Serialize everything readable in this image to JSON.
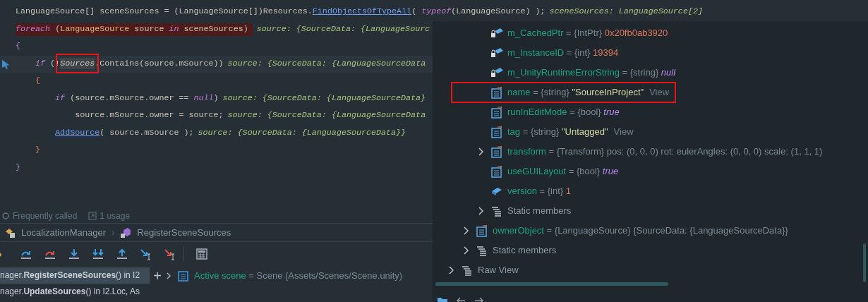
{
  "editor": {
    "lines": [
      {
        "breakpoint": false,
        "current": false,
        "tokens": [
          {
            "text": "LanguageSource",
            "kind": "plain"
          },
          {
            "text": "[] sceneSources = (LanguageSource[])Resources.",
            "kind": "plain"
          },
          {
            "text": "FindObjectsOfTypeAll",
            "kind": "method"
          },
          {
            "text": "( ",
            "kind": "plain"
          },
          {
            "text": "typeof",
            "kind": "keyword"
          },
          {
            "text": "(LanguageSource) );",
            "kind": "plain"
          }
        ],
        "hint": "sceneSources: LanguageSource[2]"
      },
      {
        "breakpoint": true,
        "current": false,
        "tokens": [
          {
            "text": "foreach",
            "kind": "keyword"
          },
          {
            "text": " (",
            "kind": "plain"
          },
          {
            "text": "LanguageSource",
            "kind": "type"
          },
          {
            "text": " source ",
            "kind": "plain"
          },
          {
            "text": "in",
            "kind": "keyword"
          },
          {
            "text": " sceneSources)",
            "kind": "plain"
          }
        ],
        "hint": "source: {SourceData: {LanguageSourc"
      },
      {
        "breakpoint": false,
        "current": false,
        "tokens": [
          {
            "text": "{",
            "kind": "brace"
          }
        ]
      },
      {
        "breakpoint": false,
        "current": true,
        "tokens": [
          {
            "text": "    if",
            "kind": "keyword"
          },
          {
            "text": " (!",
            "kind": "plain"
          },
          {
            "text": "Sources",
            "kind": "member",
            "boxed": true
          },
          {
            "text": ".Contains(source.mSource))",
            "kind": "plain"
          }
        ],
        "hint": "source: {SourceData: {LanguageSourceData"
      },
      {
        "breakpoint": false,
        "current": false,
        "tokens": [
          {
            "text": "    {",
            "kind": "inner-brace"
          }
        ]
      },
      {
        "breakpoint": false,
        "current": false,
        "tokens": [
          {
            "text": "        if",
            "kind": "keyword"
          },
          {
            "text": " (source.mSource.owner == ",
            "kind": "plain"
          },
          {
            "text": "null",
            "kind": "keyword"
          },
          {
            "text": ")",
            "kind": "plain"
          }
        ],
        "hint": "source: {SourceData: {LanguageSourceData}"
      },
      {
        "breakpoint": false,
        "current": false,
        "tokens": [
          {
            "text": "            source.mSource.owner = source;",
            "kind": "plain"
          }
        ],
        "hint": "source: {SourceData: {LanguageSourceData"
      },
      {
        "breakpoint": false,
        "current": false,
        "tokens": [
          {
            "text": "        AddSource",
            "kind": "method"
          },
          {
            "text": "( source.mSource );",
            "kind": "plain"
          }
        ],
        "hint": "source: {SourceData: {LanguageSourceData}}"
      },
      {
        "breakpoint": false,
        "current": false,
        "tokens": [
          {
            "text": "    }",
            "kind": "inner-brace"
          }
        ]
      },
      {
        "breakpoint": false,
        "current": false,
        "tokens": [
          {
            "text": "}",
            "kind": "brace"
          }
        ]
      }
    ],
    "code_lens": [
      "Frequently called",
      "1 usage"
    ]
  },
  "breadcrumbs": [
    {
      "label": "LocalizationManager",
      "kind": "class"
    },
    {
      "separator": "›",
      "label": "RegisterSceneSources",
      "kind": "method"
    }
  ],
  "debug_toolbar": [
    {
      "kind": "step-back"
    },
    {
      "kind": "step-over"
    },
    {
      "kind": "step-over-red"
    },
    {
      "kind": "step-into"
    },
    {
      "kind": "step-into-double"
    },
    {
      "kind": "step-out"
    },
    {
      "kind": "run-to-cursor"
    },
    {
      "kind": "run-to-cursor-red"
    },
    {
      "kind": "calculator"
    }
  ],
  "frames": [
    {
      "text": "nager.**RegisterSceneSources**() in I2",
      "selected": true
    },
    {
      "text": "nager.**UpdateSources**() in I2.Loc, As",
      "selected": false
    }
  ],
  "add_button": "+",
  "variables": [
    {
      "name": "Active scene",
      "value": "= Scene (Assets/Scenes/Scene.unity)"
    }
  ],
  "popup": {
    "tree": [
      {
        "children": [
          {
            "children": [
              {
                "name": "m_CachedPtr",
                "type": "= {IntPtr}",
                "value": {
                  "text": "0x20fb0ab3920",
                  "kind": "number"
                },
                "kind": "locked-field",
                "expandable": false,
                "boxed": false
              },
              {
                "name": "m_InstanceID",
                "type": "= {int}",
                "value": {
                  "text": "19394",
                  "kind": "number"
                },
                "kind": "locked-field",
                "expandable": false,
                "boxed": false
              },
              {
                "name": "m_UnityRuntimeErrorString",
                "type": "= {string}",
                "value": {
                  "text": "null",
                  "kind": "keyword"
                },
                "kind": "locked-field",
                "expandable": false,
                "boxed": false
              },
              {
                "name": "name",
                "type": "= {string}",
                "value": {
                  "text": "\"SourceInProject\"",
                  "kind": "string"
                },
                "link": "View",
                "kind": "property",
                "expandable": false,
                "boxed": true
              },
              {
                "name": "runInEditMode",
                "type": "= {bool}",
                "value": {
                  "text": "true",
                  "kind": "keyword"
                },
                "kind": "property",
                "expandable": false,
                "boxed": false
              },
              {
                "name": "tag",
                "type": "= {string}",
                "value": {
                  "text": "\"Untagged\"",
                  "kind": "string"
                },
                "link": "View",
                "kind": "property",
                "expandable": false,
                "boxed": false
              },
              {
                "name": "transform",
                "type": "= {Transform}",
                "value": {
                  "text": "pos: (0, 0, 0) rot: eulerAngles: (0, 0, 0) scale: (1, 1, 1)",
                  "kind": "plain"
                },
                "kind": "property",
                "expandable": true,
                "boxed": false
              },
              {
                "name": "useGUILayout",
                "type": "= {bool}",
                "value": {
                  "text": "true",
                  "kind": "keyword"
                },
                "kind": "property",
                "expandable": false,
                "boxed": false
              },
              {
                "name": "version",
                "type": "= {int}",
                "value": {
                  "text": "1",
                  "kind": "number"
                },
                "kind": "field",
                "expandable": false,
                "boxed": false
              },
              {
                "name": "Static members",
                "kind": "group",
                "expandable": true,
                "boxed": false
              }
            ]
          },
          {
            "name": "ownerObject",
            "type": "= {LanguageSource}",
            "value": {
              "text": "{SourceData: {LanguageSourceData}}",
              "kind": "plain"
            },
            "kind": "property",
            "expandable": true,
            "boxed": false
          },
          {
            "name": "Static members",
            "kind": "group",
            "expandable": true,
            "boxed": false
          }
        ]
      },
      {
        "name": "Raw View",
        "kind": "group",
        "expandable": true,
        "boxed": false
      }
    ],
    "footer_icons": [
      {
        "kind": "folder"
      },
      {
        "kind": "back"
      },
      {
        "kind": "forward"
      }
    ]
  }
}
